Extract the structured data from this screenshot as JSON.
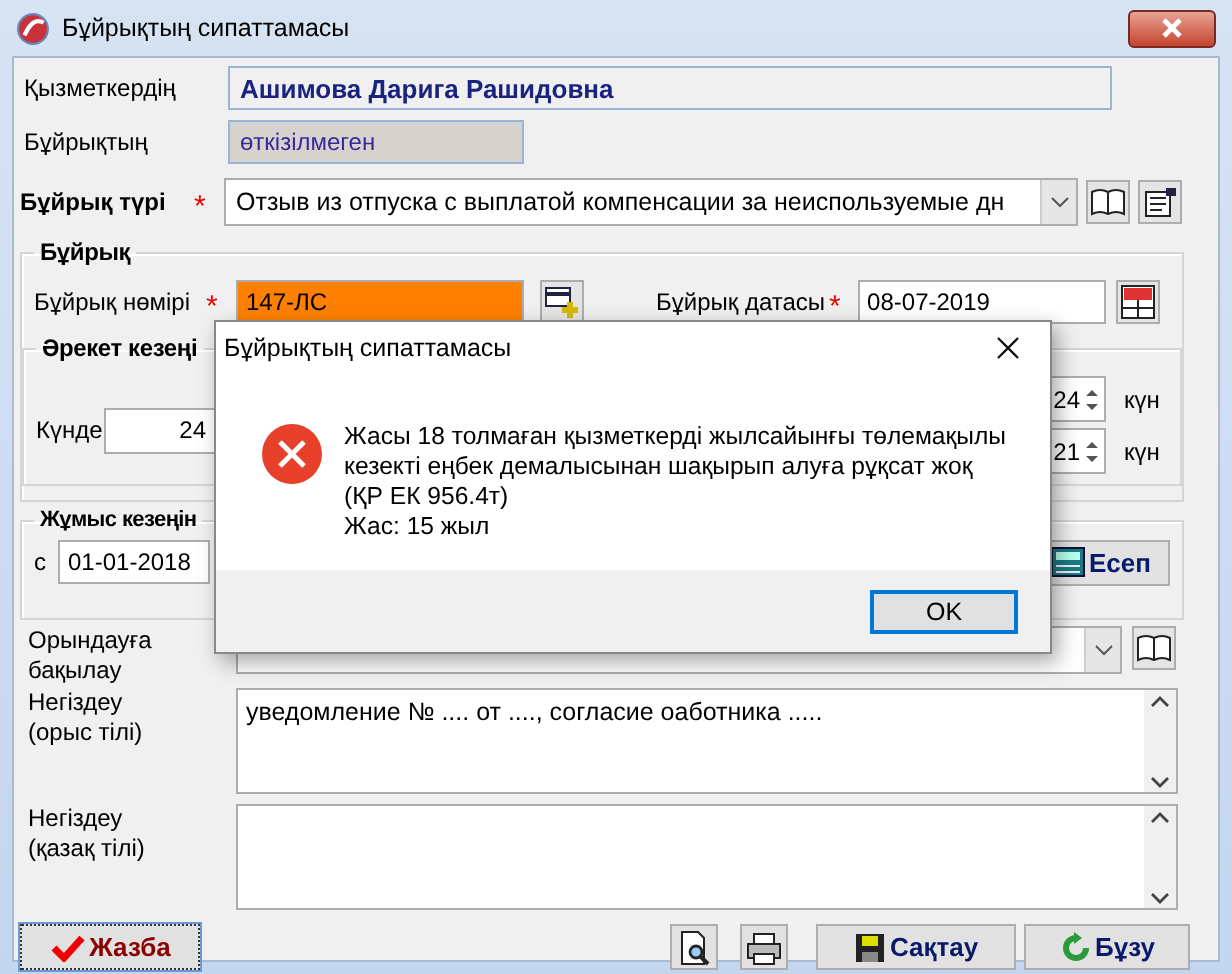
{
  "window": {
    "title": "Бұйрықтың сипаттамасы"
  },
  "employee": {
    "label": "Қызметкердің",
    "value": "Ашимова Дарига Рашидовна"
  },
  "order_status": {
    "label": "Бұйрықтың",
    "value": "өткізілмеген"
  },
  "order_type": {
    "label": "Бұйрық түрі",
    "required_mark": "*",
    "value": "Отзыв из отпуска с выплатой компенсации за неиспользуемые дн"
  },
  "order_group": {
    "title": "Бұйрық",
    "number": {
      "label": "Бұйрық нөмірі",
      "required_mark": "*",
      "value": "147-ЛС"
    },
    "date": {
      "label": "Бұйрық датасы",
      "required_mark": "*",
      "value": "08-07-2019"
    }
  },
  "action_period": {
    "title": "Әрекет кезеңі",
    "days_label": "Күнде",
    "days_value": "24",
    "spinners": [
      {
        "value": "24",
        "unit": "күн"
      },
      {
        "value": "21",
        "unit": "күн"
      }
    ]
  },
  "work_period": {
    "title": "Жұмыс кезеңін",
    "from_label": "с",
    "from_value": "01-01-2018",
    "calc_button": "Есеп"
  },
  "control": {
    "label": "Орындауға бақылау"
  },
  "basis_ru": {
    "label": "Негіздеу (орыс тілі)",
    "value": "уведомление № .... от ...., согласие оаботника ....."
  },
  "basis_kz": {
    "label": "Негіздеу (қазақ тілі)"
  },
  "buttons": [
    {
      "kind": "record",
      "label": "Жазба"
    },
    {
      "kind": "preview"
    },
    {
      "kind": "print"
    },
    {
      "kind": "save",
      "label": "Сақтау"
    },
    {
      "kind": "cancel",
      "label": "Бұзу"
    }
  ],
  "dialog": {
    "title": "Бұйрықтың сипаттамасы",
    "message": [
      "Жасы 18 толмаған қызметкерді жылсайынғы төлемақылы кезекті еңбек демалысынан шақырып алуға рұқсат жоқ (ҚР ЕК 956.4т)",
      "Жас: 15 жыл"
    ],
    "button": "OK"
  }
}
